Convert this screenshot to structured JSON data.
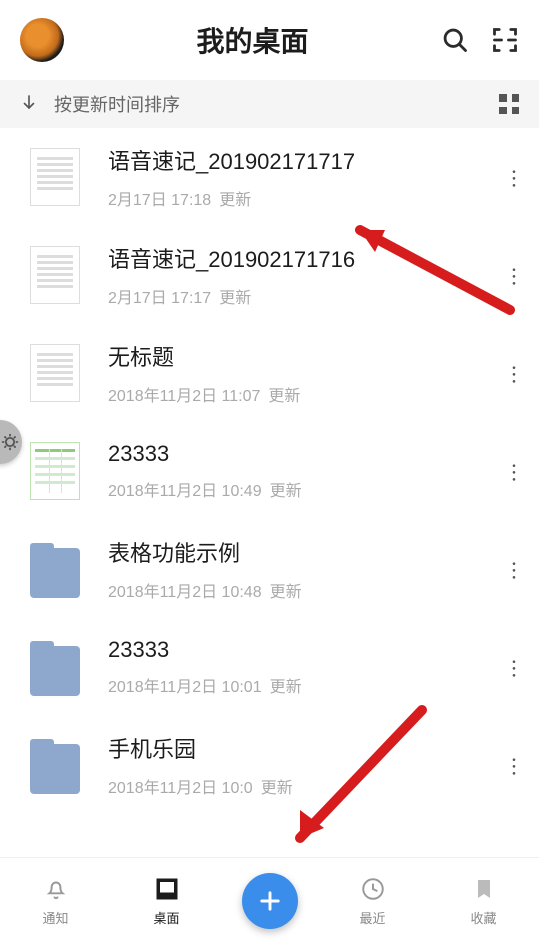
{
  "header": {
    "title": "我的桌面"
  },
  "sortbar": {
    "label": "按更新时间排序"
  },
  "update_suffix": "更新",
  "files": [
    {
      "name": "语音速记_201902171717",
      "time": "2月17日 17:18",
      "kind": "doc"
    },
    {
      "name": "语音速记_201902171716",
      "time": "2月17日 17:17",
      "kind": "doc"
    },
    {
      "name": "无标题",
      "time": "2018年11月2日 11:07",
      "kind": "doc"
    },
    {
      "name": "23333",
      "time": "2018年11月2日 10:49",
      "kind": "sheet"
    },
    {
      "name": "表格功能示例",
      "time": "2018年11月2日 10:48",
      "kind": "folder"
    },
    {
      "name": "23333",
      "time": "2018年11月2日 10:01",
      "kind": "folder"
    },
    {
      "name": "手机乐园",
      "time": "2018年11月2日 10:0",
      "kind": "folder"
    }
  ],
  "tabs": {
    "notify": "通知",
    "desktop": "桌面",
    "recent": "最近",
    "favorite": "收藏"
  }
}
